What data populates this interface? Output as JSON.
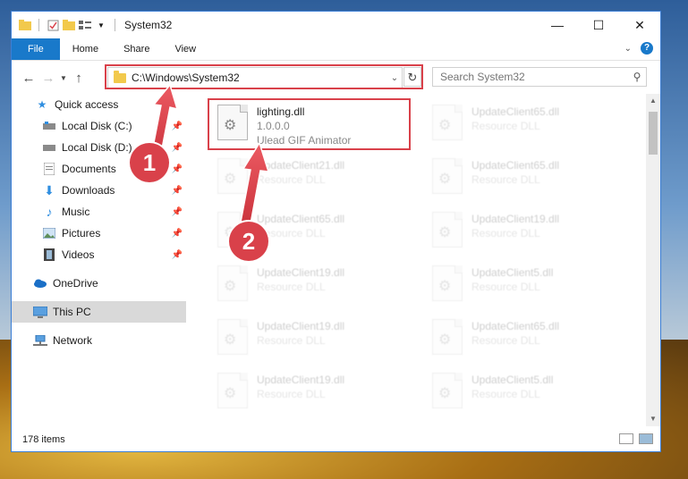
{
  "window": {
    "title": "System32",
    "controls": {
      "minimize": "—",
      "maximize": "☐",
      "close": "✕"
    }
  },
  "ribbon": {
    "tabs": [
      "File",
      "Home",
      "Share",
      "View"
    ]
  },
  "navigation": {
    "address": "C:\\Windows\\System32",
    "search_placeholder": "Search System32"
  },
  "sidebar": {
    "items": [
      {
        "label": "Quick access",
        "icon": "star-icon",
        "pinned": false
      },
      {
        "label": "Local Disk (C:)",
        "icon": "drive-icon",
        "pinned": true
      },
      {
        "label": "Local Disk (D:)",
        "icon": "drive-icon",
        "pinned": true
      },
      {
        "label": "Documents",
        "icon": "documents-icon",
        "pinned": true
      },
      {
        "label": "Downloads",
        "icon": "download-icon",
        "pinned": true
      },
      {
        "label": "Music",
        "icon": "music-icon",
        "pinned": true
      },
      {
        "label": "Pictures",
        "icon": "pictures-icon",
        "pinned": true
      },
      {
        "label": "Videos",
        "icon": "videos-icon",
        "pinned": true
      },
      {
        "label": "OneDrive",
        "icon": "cloud-icon",
        "pinned": false
      },
      {
        "label": "This PC",
        "icon": "computer-icon",
        "pinned": false
      },
      {
        "label": "Network",
        "icon": "network-icon",
        "pinned": false
      }
    ]
  },
  "files": {
    "highlighted": {
      "name": "lighting.dll",
      "version": "1.0.0.0",
      "company": "Ulead GIF Animator"
    },
    "grid": [
      {
        "name": "UpdateClient65.dll",
        "type": "Resource DLL"
      },
      {
        "name": "UpdateClient21.dll",
        "type": "Resource DLL"
      },
      {
        "name": "UpdateClient65.dll",
        "type": "Resource DLL"
      },
      {
        "name": "UpdateClient65.dll",
        "type": "Resource DLL"
      },
      {
        "name": "UpdateClient19.dll",
        "type": "Resource DLL"
      },
      {
        "name": "UpdateClient19.dll",
        "type": "Resource DLL"
      },
      {
        "name": "UpdateClient5.dll",
        "type": "Resource DLL"
      },
      {
        "name": "UpdateClient19.dll",
        "type": "Resource DLL"
      },
      {
        "name": "UpdateClient65.dll",
        "type": "Resource DLL"
      },
      {
        "name": "UpdateClient19.dll",
        "type": "Resource DLL"
      },
      {
        "name": "UpdateClient5.dll",
        "type": "Resource DLL"
      }
    ]
  },
  "status": {
    "item_count": "178 items"
  },
  "annotations": {
    "step1": "1",
    "step2": "2",
    "color": "#d9414a"
  }
}
